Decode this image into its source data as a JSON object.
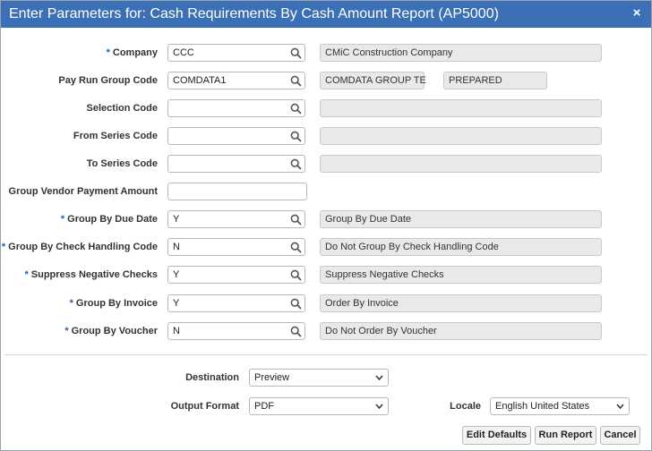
{
  "dialog": {
    "title": "Enter Parameters for: Cash Requirements By Cash Amount Report (AP5000)",
    "close": "×"
  },
  "params": [
    {
      "label": "Company",
      "required": "*",
      "value": "CCC",
      "lookup": true,
      "desc": "CMiC Construction Company"
    },
    {
      "label": "Pay Run Group Code",
      "required": "",
      "value": "COMDATA1",
      "lookup": true,
      "desc": "COMDATA GROUP TE",
      "desc2": "PREPARED"
    },
    {
      "label": "Selection Code",
      "required": "",
      "value": "",
      "lookup": true,
      "desc": ""
    },
    {
      "label": "From Series Code",
      "required": "",
      "value": "",
      "lookup": true,
      "desc": ""
    },
    {
      "label": "To Series Code",
      "required": "",
      "value": "",
      "lookup": true,
      "desc": ""
    },
    {
      "label": "Group Vendor Payment Amount",
      "required": "",
      "value": "",
      "lookup": false
    },
    {
      "label": "Group By Due Date",
      "required": "*",
      "value": "Y",
      "lookup": true,
      "desc": "Group By Due Date"
    },
    {
      "label": "Group By Check Handling Code",
      "required": "*",
      "value": "N",
      "lookup": true,
      "desc": "Do Not Group By Check Handling Code"
    },
    {
      "label": "Suppress Negative Checks",
      "required": "*",
      "value": "Y",
      "lookup": true,
      "desc": "Suppress Negative Checks"
    },
    {
      "label": "Group By Invoice",
      "required": "*",
      "value": "Y",
      "lookup": true,
      "desc": "Order By Invoice"
    },
    {
      "label": "Group By Voucher",
      "required": "*",
      "value": "N",
      "lookup": true,
      "desc": "Do Not Order By Voucher"
    }
  ],
  "output": {
    "destination_label": "Destination",
    "destination_value": "Preview",
    "format_label": "Output Format",
    "format_value": "PDF",
    "locale_label": "Locale",
    "locale_value": "English United States"
  },
  "buttons": {
    "edit_defaults": "Edit Defaults",
    "run_report": "Run Report",
    "cancel": "Cancel"
  },
  "icons": {
    "lookup": "magnifier-icon",
    "dropdown": "chevron-down-icon",
    "close": "close-icon"
  },
  "colors": {
    "titlebar": "#3b6fb6",
    "required": "#1f5fbf",
    "readonly_bg": "#e9e9e9"
  }
}
